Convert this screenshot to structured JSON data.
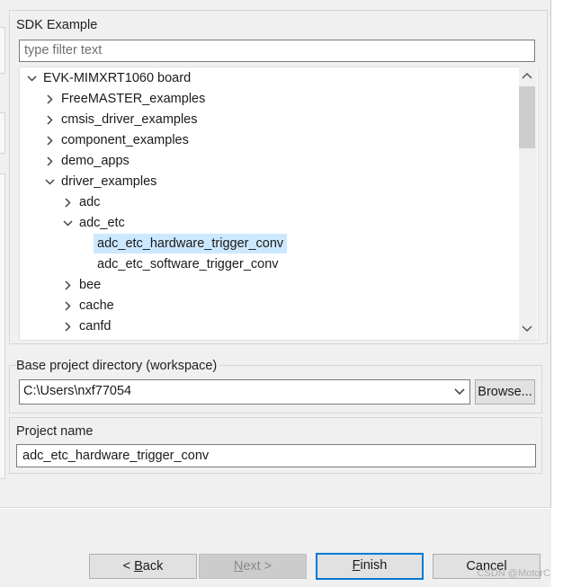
{
  "sdk_group": {
    "label": "SDK Example",
    "filter_placeholder": "type filter text",
    "filter_value": ""
  },
  "tree": {
    "items": [
      {
        "label": "EVK-MIMXRT1060 board",
        "level": 0,
        "expanded": true,
        "has_children": true
      },
      {
        "label": "FreeMASTER_examples",
        "level": 1,
        "expanded": false,
        "has_children": true
      },
      {
        "label": "cmsis_driver_examples",
        "level": 1,
        "expanded": false,
        "has_children": true
      },
      {
        "label": "component_examples",
        "level": 1,
        "expanded": false,
        "has_children": true
      },
      {
        "label": "demo_apps",
        "level": 1,
        "expanded": false,
        "has_children": true
      },
      {
        "label": "driver_examples",
        "level": 1,
        "expanded": true,
        "has_children": true
      },
      {
        "label": "adc",
        "level": 2,
        "expanded": false,
        "has_children": true
      },
      {
        "label": "adc_etc",
        "level": 2,
        "expanded": true,
        "has_children": true
      },
      {
        "label": "adc_etc_hardware_trigger_conv",
        "level": 3,
        "expanded": false,
        "has_children": false,
        "selected": true
      },
      {
        "label": "adc_etc_software_trigger_conv",
        "level": 3,
        "expanded": false,
        "has_children": false
      },
      {
        "label": "bee",
        "level": 2,
        "expanded": false,
        "has_children": true
      },
      {
        "label": "cache",
        "level": 2,
        "expanded": false,
        "has_children": true
      },
      {
        "label": "canfd",
        "level": 2,
        "expanded": false,
        "has_children": true
      }
    ]
  },
  "base_dir": {
    "label": "Base project directory (workspace)",
    "value": "C:\\Users\\nxf77054",
    "browse_label": "Browse..."
  },
  "project": {
    "label": "Project name",
    "value": "adc_etc_hardware_trigger_conv"
  },
  "footer": {
    "back_prefix": "< ",
    "back_mnemonic": "B",
    "back_rest": "ack",
    "next_mnemonic": "N",
    "next_rest": "ext >",
    "finish_mnemonic": "F",
    "finish_rest": "inish",
    "cancel_label": "Cancel"
  },
  "watermark": "CSDN @MotorC",
  "colors": {
    "selection": "#cce8ff",
    "default_button_border": "#0078d7",
    "dialog_background": "#f0f0f0"
  }
}
